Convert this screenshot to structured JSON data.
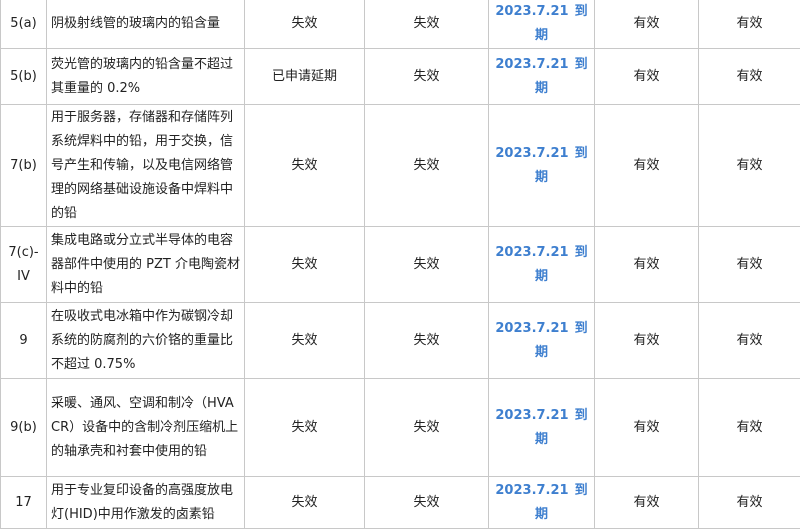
{
  "rows": [
    {
      "item": "5(a)",
      "desc": "阴极射线管的玻璃内的铅含量",
      "c1": "失效",
      "c2": "失效",
      "date": "2023.7.21",
      "due": "到期",
      "c3": "有效",
      "c4": "有效"
    },
    {
      "item": "5(b)",
      "desc": "荧光管的玻璃内的铅含量不超过其重量的 0.2%",
      "c1": "已申请延期",
      "c2": "失效",
      "date": "2023.7.21",
      "due": "到期",
      "c3": "有效",
      "c4": "有效"
    },
    {
      "item": "7(b)",
      "desc": "用于服务器，存储器和存储阵列系统焊料中的铅，用于交换，信号产生和传输，以及电信网络管理的网络基础设施设备中焊料中的铅",
      "c1": "失效",
      "c2": "失效",
      "date": "2023.7.21",
      "due": "到期",
      "c3": "有效",
      "c4": "有效"
    },
    {
      "item": "7(c)-IV",
      "desc": "集成电路或分立式半导体的电容器部件中使用的 PZT 介电陶瓷材料中的铅",
      "c1": "失效",
      "c2": "失效",
      "date": "2023.7.21",
      "due": "到期",
      "c3": "有效",
      "c4": "有效"
    },
    {
      "item": "9",
      "desc": "在吸收式电冰箱中作为碳钢冷却系统的防腐剂的六价铬的重量比不超过 0.75%",
      "c1": "失效",
      "c2": "失效",
      "date": "2023.7.21",
      "due": "到期",
      "c3": "有效",
      "c4": "有效"
    },
    {
      "item": "9(b)",
      "desc": "采暖、通风、空调和制冷（HVACR）设备中的含制冷剂压缩机上的轴承壳和衬套中使用的铅",
      "c1": "失效",
      "c2": "失效",
      "date": "2023.7.21",
      "due": "到期",
      "c3": "有效",
      "c4": "有效"
    },
    {
      "item": "17",
      "desc": "用于专业复印设备的高强度放电灯(HID)中用作激发的卤素铅",
      "c1": "失效",
      "c2": "失效",
      "date": "2023.7.21",
      "due": "到期",
      "c3": "有效",
      "c4": "有效"
    }
  ]
}
